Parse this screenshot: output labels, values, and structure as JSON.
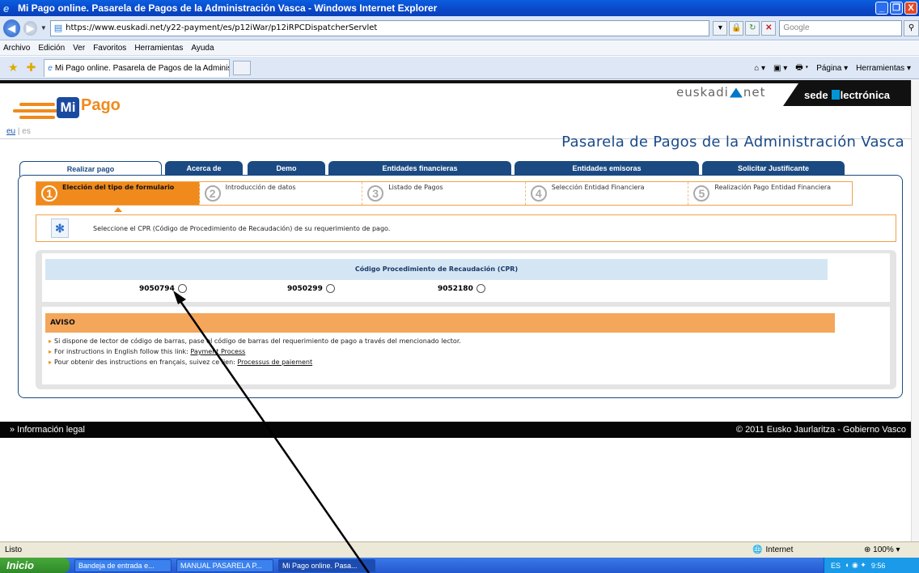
{
  "window": {
    "title": "Mi Pago online. Pasarela de Pagos de la Administración Vasca - Windows Internet Explorer",
    "minimize": "_",
    "restore": "❐",
    "close": "X"
  },
  "addressbar": {
    "url": "https://www.euskadi.net/y22-payment/es/p12iWar/p12iRPCDispatcherServlet",
    "search_placeholder": "Google"
  },
  "menu": [
    "Archivo",
    "Edición",
    "Ver",
    "Favoritos",
    "Herramientas",
    "Ayuda"
  ],
  "browser_tab": {
    "title": "Mi Pago online. Pasarela de Pagos de la Administració..."
  },
  "command_bar": {
    "page": "Página",
    "tools": "Herramientas"
  },
  "site": {
    "logo_mi": "Mi",
    "logo_pago": "Pago",
    "euskadi_left": "euskadi",
    "euskadi_right": "net",
    "sede_left": "sede",
    "sede_right": "lectrónica",
    "lang_eu": "eu",
    "lang_sep": "|",
    "lang_es": "es",
    "heading": "Pasarela de Pagos de la Administración Vasca"
  },
  "tabs": [
    {
      "label": "Realizar pago"
    },
    {
      "label": "Acerca de"
    },
    {
      "label": "Demo"
    },
    {
      "label": "Entidades financieras"
    },
    {
      "label": "Entidades emisoras"
    },
    {
      "label": "Solicitar Justificante"
    }
  ],
  "steps": [
    {
      "num": "1",
      "label": "Elección del tipo de formulario"
    },
    {
      "num": "2",
      "label": "Introducción de datos"
    },
    {
      "num": "3",
      "label": "Listado de Pagos"
    },
    {
      "num": "4",
      "label": "Selección Entidad Financiera"
    },
    {
      "num": "5",
      "label": "Realización Pago Entidad Financiera"
    }
  ],
  "info": {
    "text": "Seleccione el CPR (Código de Procedimiento de Recaudación) de su requerimiento de pago."
  },
  "cpr": {
    "header": "Código Procedimiento de Recaudación (CPR)",
    "options": [
      "9050794",
      "9050299",
      "9052180"
    ]
  },
  "aviso": {
    "title": "AVISO",
    "line1": "Si dispone de lector de código de barras, pase el código de barras del requerimiento de pago a través del mencionado lector.",
    "line2_prefix": "For instructions in English follow this link:",
    "line2_link": "Payment Process",
    "line3_prefix": "Pour obtenir des instructions en français, suivez ce lien:",
    "line3_link": "Processus de paiement"
  },
  "footer": {
    "legal": "» Información legal",
    "copyright": "© 2011 Eusko Jaurlaritza - Gobierno Vasco"
  },
  "statusbar": {
    "status": "Listo",
    "zone": "Internet",
    "zoom": "100%"
  },
  "taskbar": {
    "start": "Inicio",
    "tasks": [
      "Bandeja de entrada e...",
      "MANUAL PASARELA P...",
      "Mi Pago online. Pasa..."
    ],
    "lang": "ES",
    "clock": "9:56"
  }
}
